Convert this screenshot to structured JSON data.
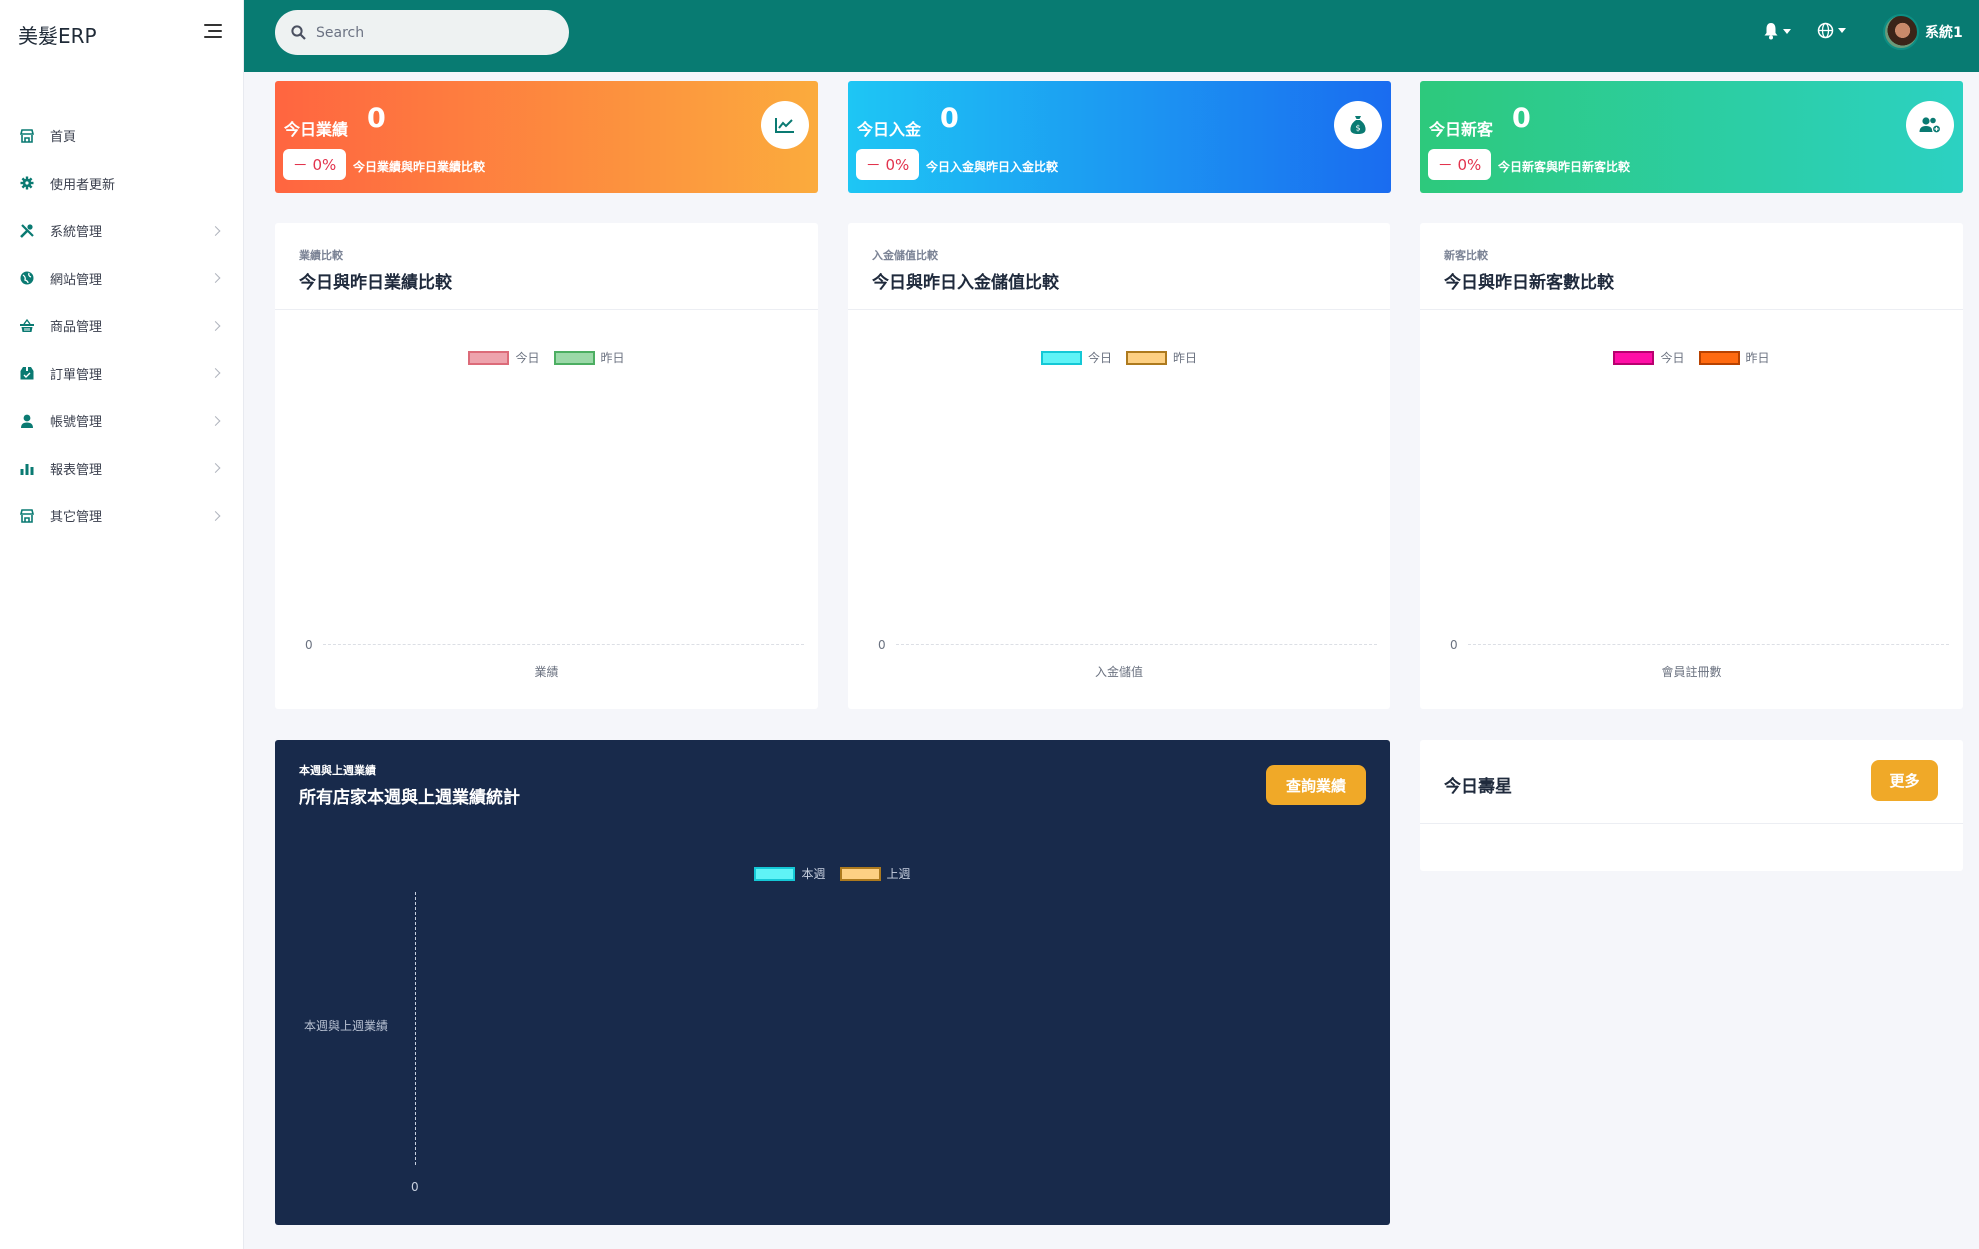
{
  "app": {
    "brand": "美髮ERP"
  },
  "sidebar": {
    "items": [
      {
        "label": "首頁",
        "icon": "store-icon",
        "expandable": false
      },
      {
        "label": "使用者更新",
        "icon": "gear-icon",
        "expandable": false
      },
      {
        "label": "系統管理",
        "icon": "tools-icon",
        "expandable": true
      },
      {
        "label": "網站管理",
        "icon": "globe-icon",
        "expandable": true
      },
      {
        "label": "商品管理",
        "icon": "basket-icon",
        "expandable": true
      },
      {
        "label": "訂單管理",
        "icon": "box-icon",
        "expandable": true
      },
      {
        "label": "帳號管理",
        "icon": "user-icon",
        "expandable": true
      },
      {
        "label": "報表管理",
        "icon": "bar-chart-icon",
        "expandable": true
      },
      {
        "label": "其它管理",
        "icon": "shop-icon",
        "expandable": true
      }
    ]
  },
  "topbar": {
    "search_placeholder": "Search",
    "user_name": "系統1"
  },
  "stats": [
    {
      "title": "今日業績",
      "value": "0",
      "badge": "－ 0%",
      "desc": "今日業績與昨日業績比較",
      "icon": "trend-chart-icon",
      "accent": "#ff6a3d"
    },
    {
      "title": "今日入金",
      "value": "0",
      "badge": "－ 0%",
      "desc": "今日入金與昨日入金比較",
      "icon": "money-bag-icon",
      "accent": "#1aa7ee"
    },
    {
      "title": "今日新客",
      "value": "0",
      "badge": "－ 0%",
      "desc": "今日新客與昨日新客比較",
      "icon": "user-plus-icon",
      "accent": "#2fcc8b"
    }
  ],
  "panels": [
    {
      "kicker": "業績比較",
      "title": "今日與昨日業績比較",
      "legend": [
        "今日",
        "昨日"
      ],
      "xlabel": "業績",
      "zero": "0"
    },
    {
      "kicker": "入金儲值比較",
      "title": "今日與昨日入金儲值比較",
      "legend": [
        "今日",
        "昨日"
      ],
      "xlabel": "入金儲值",
      "zero": "0"
    },
    {
      "kicker": "新客比較",
      "title": "今日與昨日新客數比較",
      "legend": [
        "今日",
        "昨日"
      ],
      "xlabel": "會員註冊數",
      "zero": "0"
    }
  ],
  "weekly": {
    "kicker": "本週與上週業績",
    "title": "所有店家本週與上週業績統計",
    "button": "查詢業績",
    "legend": [
      "本週",
      "上週"
    ],
    "ylabel": "本週與上週業績",
    "zero": "0"
  },
  "birthday": {
    "title": "今日壽星",
    "button": "更多"
  },
  "chart_data": [
    {
      "type": "bar",
      "title": "今日與昨日業績比較",
      "xlabel": "業績",
      "series": [
        {
          "name": "今日",
          "values": []
        },
        {
          "name": "昨日",
          "values": []
        }
      ],
      "ylim": [
        0,
        0
      ]
    },
    {
      "type": "bar",
      "title": "今日與昨日入金儲值比較",
      "xlabel": "入金儲值",
      "series": [
        {
          "name": "今日",
          "values": []
        },
        {
          "name": "昨日",
          "values": []
        }
      ],
      "ylim": [
        0,
        0
      ]
    },
    {
      "type": "bar",
      "title": "今日與昨日新客數比較",
      "xlabel": "會員註冊數",
      "series": [
        {
          "name": "今日",
          "values": []
        },
        {
          "name": "昨日",
          "values": []
        }
      ],
      "ylim": [
        0,
        0
      ]
    },
    {
      "type": "bar",
      "title": "所有店家本週與上週業績統計",
      "ylabel": "本週與上週業績",
      "series": [
        {
          "name": "本週",
          "values": []
        },
        {
          "name": "上週",
          "values": []
        }
      ]
    }
  ]
}
